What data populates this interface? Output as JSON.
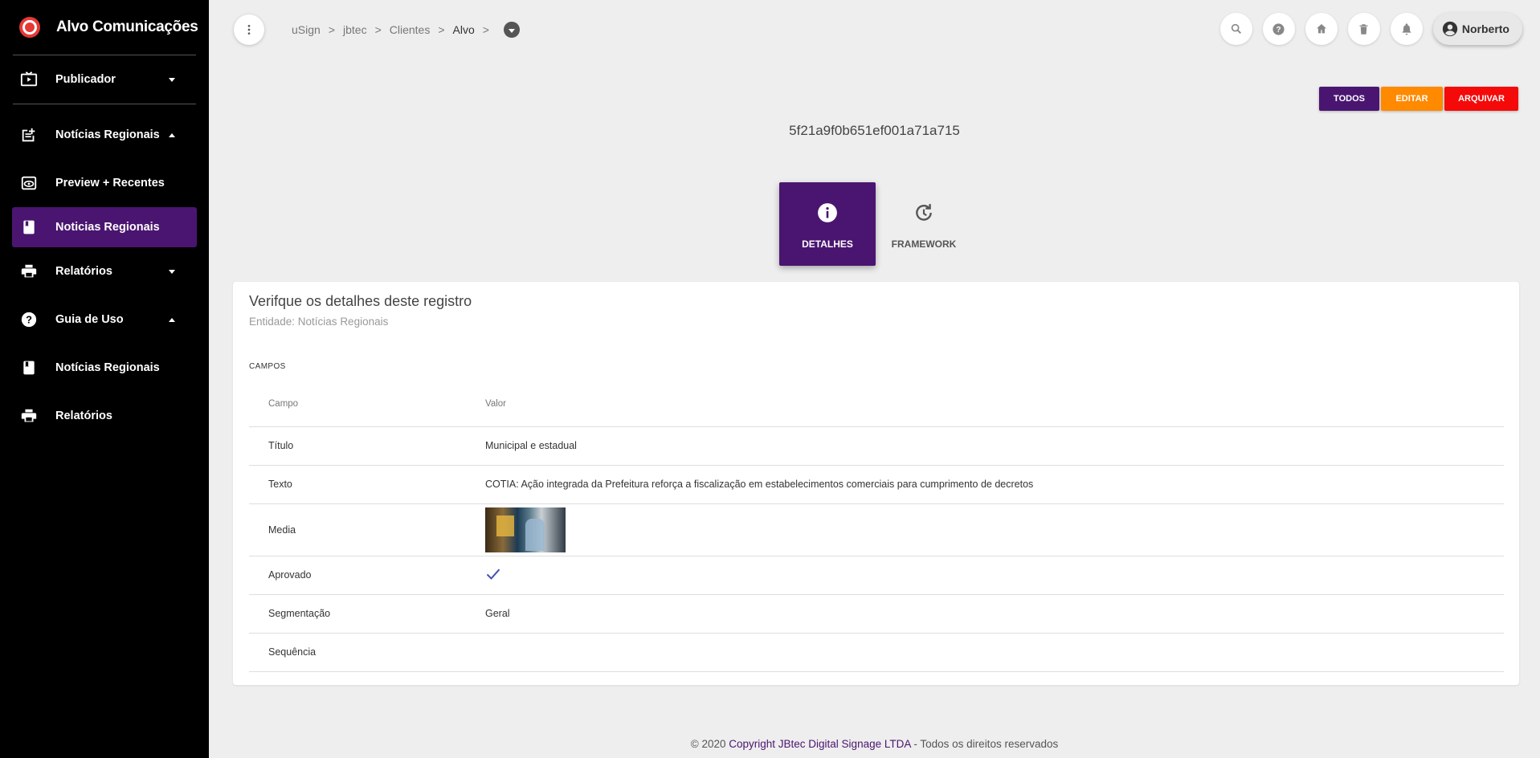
{
  "sidebar": {
    "brand": "Alvo Comunicações",
    "items": [
      {
        "label": "Publicador",
        "icon": "tv-play-icon"
      },
      {
        "label": "Notícias Regionais",
        "icon": "post-add-icon"
      },
      {
        "label": "Preview + Recentes",
        "icon": "preview-icon"
      },
      {
        "label": "Noticias Regionais",
        "icon": "book-icon"
      },
      {
        "label": "Relatórios",
        "icon": "printer-icon"
      },
      {
        "label": "Guia de Uso",
        "icon": "help-icon"
      },
      {
        "label": "Notícias Regionais",
        "icon": "book-icon"
      },
      {
        "label": "Relatórios",
        "icon": "printer-icon"
      }
    ]
  },
  "breadcrumb": [
    "uSign",
    ">",
    "jbtec",
    ">",
    "Clientes",
    ">",
    "Alvo",
    ">"
  ],
  "user": {
    "name": "Norberto"
  },
  "actions": {
    "todos": "TODOS",
    "editar": "EDITAR",
    "arquivar": "ARQUIVAR"
  },
  "record_id": "5f21a9f0b651ef001a71a715",
  "tabs": {
    "detalhes": "DETALHES",
    "framework": "FRAMEWORK"
  },
  "card": {
    "title": "Verifque os detalhes deste registro",
    "subtitle": "Entidade: Notícias Regionais",
    "section": "CAMPOS",
    "headers": {
      "campo": "Campo",
      "valor": "Valor"
    },
    "rows": {
      "titulo": {
        "field": "Título",
        "value": "Municipal e estadual"
      },
      "texto": {
        "field": "Texto",
        "value": "COTIA: Ação integrada da Prefeitura reforça a fiscalização em estabelecimentos comerciais para cumprimento de decretos"
      },
      "media": {
        "field": "Media"
      },
      "aprovado": {
        "field": "Aprovado"
      },
      "segmentacao": {
        "field": "Segmentação",
        "value": "Geral"
      },
      "sequencia": {
        "field": "Sequência",
        "value": ""
      }
    }
  },
  "footer": {
    "prefix": "© 2020",
    "link": "Copyright JBtec Digital Signage LTDA",
    "suffix": " - Todos os direitos reservados"
  },
  "colors": {
    "primary": "#4a1570",
    "orange": "#ff8a00",
    "red": "#f50a0a",
    "sidebar": "#000000",
    "background": "#eeeeee"
  }
}
